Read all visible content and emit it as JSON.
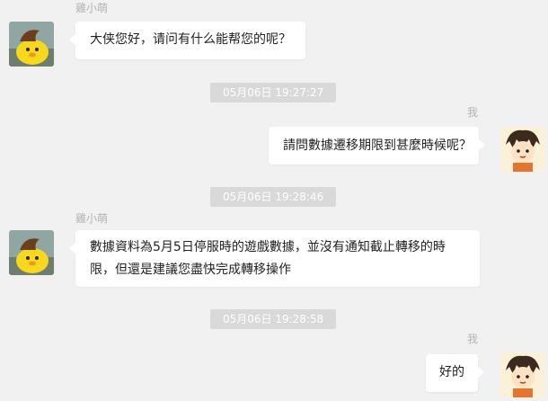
{
  "bot": {
    "name": "雞小萌",
    "avatar_icon": "yellow-chick-avatar-icon"
  },
  "user": {
    "name": "我",
    "avatar_icon": "cartoon-girl-avatar-icon"
  },
  "messages": [
    {
      "sender": "bot",
      "text": "大侠您好，请问有什么能帮您的呢？"
    },
    {
      "timestamp": "05月06日 19:27:27"
    },
    {
      "sender": "user",
      "text": "請問數據遷移期限到甚麼時候呢？"
    },
    {
      "timestamp": "05月06日 19:28:46"
    },
    {
      "sender": "bot",
      "line1": "數據資料為5月5日停服時的遊戲數據，並沒有通知截止轉移的時",
      "line2": "限，但還是建議您盡快完成轉移操作"
    },
    {
      "timestamp": "05月06日 19:28:58"
    },
    {
      "sender": "user",
      "text": "好的"
    }
  ],
  "colors": {
    "background": "#f1f1f1",
    "bubble": "#ffffff",
    "time_badge": "#d9d9d9",
    "name_text": "#b3b3b3"
  }
}
